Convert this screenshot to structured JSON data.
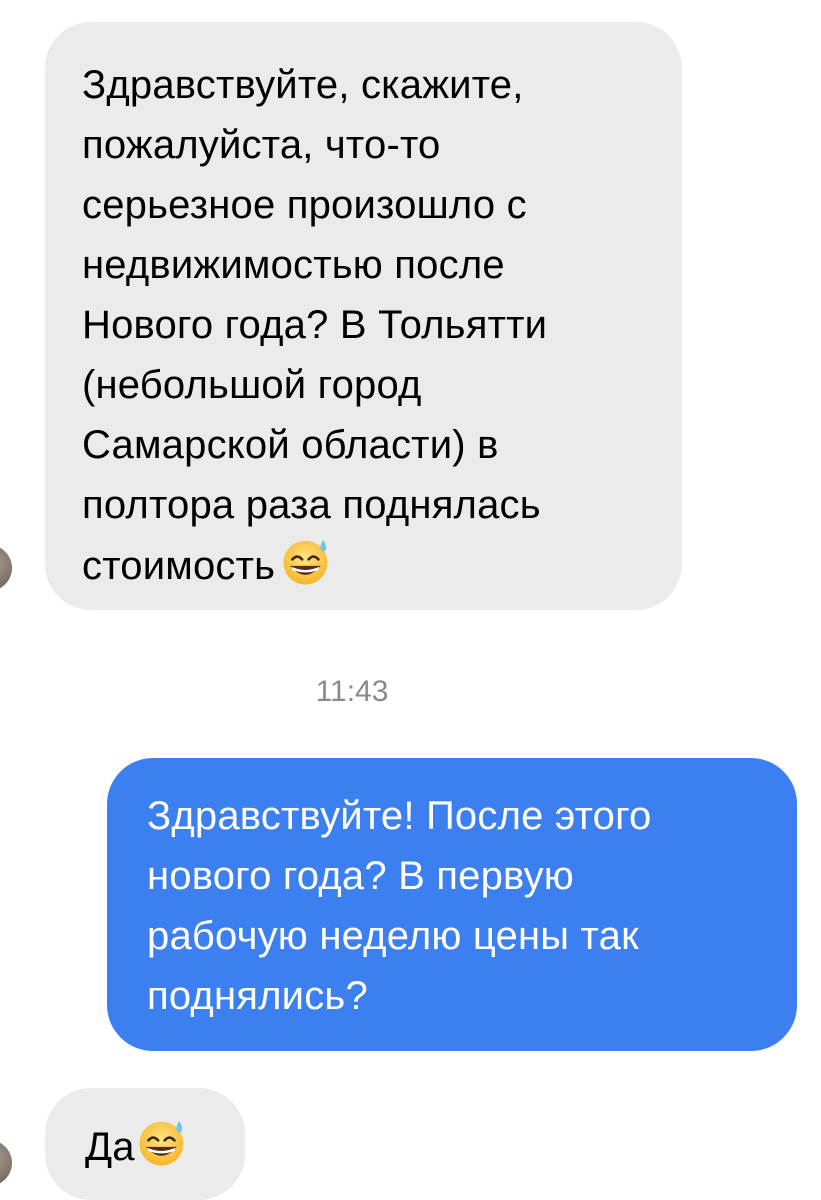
{
  "messages": [
    {
      "direction": "incoming",
      "lines": [
        "Здравствуйте, скажите,",
        "пожалуйста, что-то",
        "серьезное произошло с",
        "недвижимостью после",
        "Нового года? В Тольятти",
        "(небольшой город",
        "Самарской области) в",
        "полтора раза поднялась",
        "стоимость"
      ],
      "trailing_emoji": "grinning-face-with-sweat-icon"
    },
    {
      "direction": "outgoing",
      "lines": [
        "Здравствуйте! После этого",
        "нового года? В первую",
        "рабочую неделю цены так",
        "поднялись?"
      ]
    },
    {
      "direction": "incoming",
      "lines": [
        "Да"
      ],
      "trailing_emoji": "grinning-face-with-sweat-icon"
    }
  ],
  "timestamp": "11:43",
  "colors": {
    "incoming_bubble": "#ebebeb",
    "outgoing_bubble": "#3c7ff0",
    "timestamp_text": "#8a8a8e"
  }
}
